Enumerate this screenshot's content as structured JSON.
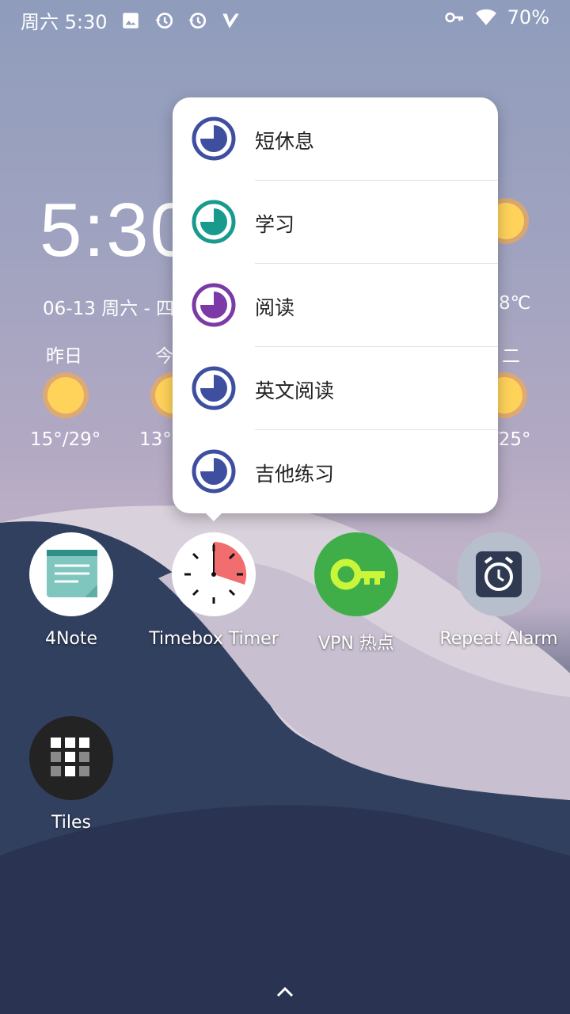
{
  "status_bar": {
    "time": "周六 5:30",
    "battery": "70%",
    "icons_left": [
      "image-icon",
      "history-icon",
      "history-icon",
      "v-icon"
    ],
    "icons_right": [
      "vpn-key-icon",
      "wifi-icon"
    ]
  },
  "widget": {
    "clock": "5:30",
    "date": "06-13 周六 - 四",
    "temp_right": "8℃",
    "days": [
      {
        "label": "昨日",
        "temp": "15°/29°"
      },
      {
        "label": "今",
        "temp": "13°"
      },
      {
        "label": "二",
        "temp": "/25°"
      }
    ]
  },
  "shortcut_menu": {
    "items": [
      {
        "label": "短休息",
        "color": "#3f4fa0",
        "icon": "timer-icon"
      },
      {
        "label": "学习",
        "color": "#189b8c",
        "icon": "timer-icon"
      },
      {
        "label": "阅读",
        "color": "#7b3aa6",
        "icon": "timer-icon"
      },
      {
        "label": "英文阅读",
        "color": "#3f4fa0",
        "icon": "timer-icon"
      },
      {
        "label": "吉他练习",
        "color": "#3f4fa0",
        "icon": "timer-icon"
      }
    ]
  },
  "apps": [
    {
      "label": "4Note",
      "icon": "note-icon"
    },
    {
      "label": "Timebox Timer",
      "icon": "timer-clock-icon"
    },
    {
      "label": "VPN 热点",
      "icon": "key-icon"
    },
    {
      "label": "Repeat Alarm",
      "icon": "alarm-icon"
    },
    {
      "label": "Tiles",
      "icon": "tiles-icon"
    }
  ],
  "colors": {
    "accent_blue": "#3f4fa0",
    "accent_teal": "#189b8c",
    "accent_purple": "#7b3aa6"
  }
}
